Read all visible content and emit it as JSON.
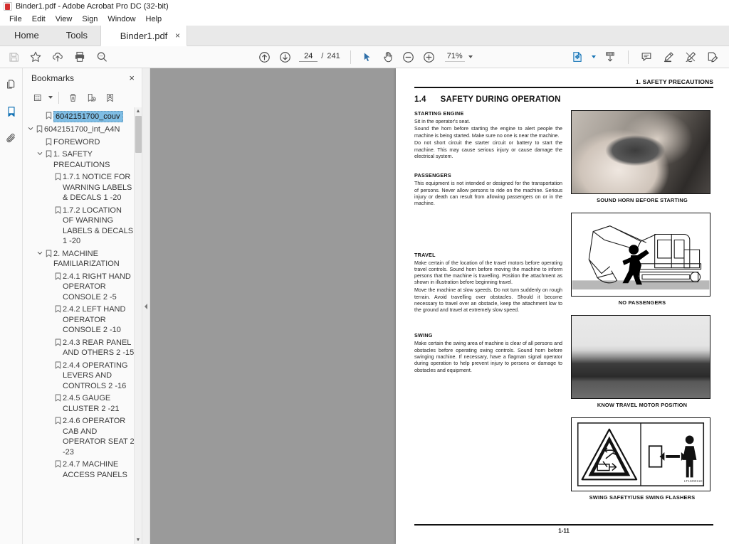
{
  "window": {
    "title": "Binder1.pdf - Adobe Acrobat Pro DC (32-bit)",
    "app_icon": "pdf-file-icon"
  },
  "menubar": {
    "items": [
      {
        "label": "File"
      },
      {
        "label": "Edit"
      },
      {
        "label": "View"
      },
      {
        "label": "Sign"
      },
      {
        "label": "Window"
      },
      {
        "label": "Help"
      }
    ]
  },
  "tabs": {
    "home": "Home",
    "tools": "Tools",
    "document": "Binder1.pdf",
    "close_glyph": "×"
  },
  "toolbar": {
    "left_icons": [
      {
        "name": "save-icon",
        "label": "Save",
        "disabled": true
      },
      {
        "name": "star-icon",
        "label": "Add to favorites",
        "disabled": false
      },
      {
        "name": "cloud-upload-icon",
        "label": "Upload to cloud",
        "disabled": false
      },
      {
        "name": "print-icon",
        "label": "Print file",
        "disabled": false
      },
      {
        "name": "search-icon",
        "label": "Find text",
        "disabled": false
      }
    ],
    "page_prev": "Previous page",
    "page_next": "Next page",
    "page_current": "24",
    "page_separator": "/",
    "page_total": "241",
    "select_tool": "Select tool",
    "hand_tool": "Hand tool",
    "zoom_out": "Zoom out",
    "zoom_in": "Zoom in",
    "zoom_value": "71%",
    "fit_page": "Fit page",
    "scroll_mode": "Page display / scroll mode",
    "comment": "Add comment",
    "highlight": "Highlight text",
    "draw": "Draw free form",
    "sign": "Fill and sign"
  },
  "rail": {
    "items": [
      {
        "name": "page-thumbnails-icon",
        "label": "Page Thumbnails",
        "selected": false
      },
      {
        "name": "bookmarks-icon",
        "label": "Bookmarks",
        "selected": true
      },
      {
        "name": "attachments-icon",
        "label": "Attachments",
        "selected": false
      }
    ]
  },
  "bookmarks_panel": {
    "title": "Bookmarks",
    "close_glyph": "×",
    "tools": [
      {
        "name": "bookmark-options-icon",
        "label": "Options"
      },
      {
        "name": "delete-bookmark-icon",
        "label": "Delete selected bookmarks"
      },
      {
        "name": "new-bookmark-icon",
        "label": "New bookmark"
      },
      {
        "name": "bookmark-properties-icon",
        "label": "Bookmark properties"
      }
    ],
    "scroll_up_glyph": "▲",
    "scroll_down_glyph": "▼",
    "items": [
      {
        "label": "6042151700_couv",
        "indent": 1,
        "twisty": "none",
        "selected": true
      },
      {
        "label": "6042151700_int_A4N",
        "indent": 0,
        "twisty": "open",
        "selected": false
      },
      {
        "label": "FOREWORD",
        "indent": 1,
        "twisty": "none",
        "selected": false
      },
      {
        "label": "1. SAFETY PRECAUTIONS",
        "indent": 1,
        "twisty": "open",
        "selected": false
      },
      {
        "label": "1.7.1 NOTICE FOR WARNING LABELS & DECALS 1 -20",
        "indent": 2,
        "twisty": "none",
        "selected": false
      },
      {
        "label": "1.7.2 LOCATION OF WARNING LABELS & DECALS 1 -20",
        "indent": 2,
        "twisty": "none",
        "selected": false
      },
      {
        "label": "2. MACHINE FAMILIARIZATION",
        "indent": 1,
        "twisty": "open",
        "selected": false
      },
      {
        "label": "2.4.1 RIGHT HAND OPERATOR CONSOLE 2 -5",
        "indent": 2,
        "twisty": "none",
        "selected": false
      },
      {
        "label": "2.4.2 LEFT HAND OPERATOR CONSOLE 2 -10",
        "indent": 2,
        "twisty": "none",
        "selected": false
      },
      {
        "label": "2.4.3 REAR PANEL AND OTHERS 2 -15",
        "indent": 2,
        "twisty": "none",
        "selected": false
      },
      {
        "label": "2.4.4 OPERATING LEVERS AND CONTROLS 2 -16",
        "indent": 2,
        "twisty": "none",
        "selected": false
      },
      {
        "label": "2.4.5 GAUGE CLUSTER 2 -21",
        "indent": 2,
        "twisty": "none",
        "selected": false
      },
      {
        "label": "2.4.6 OPERATOR CAB AND OPERATOR SEAT 2 -23",
        "indent": 2,
        "twisty": "none",
        "selected": false
      },
      {
        "label": "2.4.7 MACHINE ACCESS PANELS",
        "indent": 2,
        "twisty": "none",
        "selected": false
      }
    ]
  },
  "document": {
    "running_header": "1. SAFETY PRECAUTIONS",
    "section_number": "1.4",
    "section_title": "SAFETY DURING OPERATION",
    "page_footer": "1-11",
    "blocks": [
      {
        "heading": "STARTING ENGINE",
        "paragraphs": [
          "Sit in the operator's seat.",
          "Sound the horn before starting the engine to alert people the machine is being started. Make sure no one is near the machine.",
          "Do not short circuit the starter circuit or battery to start the machine. This may cause serious injury or cause damage the electrical system."
        ]
      },
      {
        "heading": "PASSENGERS",
        "paragraphs": [
          "This equipment is not intended or designed for the transportation of persons. Never allow persons to ride on the machine. Serious injury or death can result from allowing passengers on or in the machine."
        ]
      },
      {
        "heading": "TRAVEL",
        "paragraphs": [
          "Make certain of the location of the travel motors before operating travel controls. Sound horn before moving the machine to inform persons that the machine is travelling. Position the attachment as shown in illustration before beginning travel.",
          "Move the machine at slow speeds. Do not turn suddenly on rough terrain. Avoid travelling over obstacles. Should it become necessary to travel over an obstacle, keep the attachment low to the ground and travel at extremely slow speed."
        ]
      },
      {
        "heading": "SWING",
        "paragraphs": [
          "Make certain the swing area of machine is clear of all persons and obstacles before operating swing controls. Sound horn before swinging machine. If necessary, have a flagman signal operator during operation to help prevent injury to persons or damage to obstacles and equipment."
        ]
      }
    ],
    "figures": [
      {
        "name": "figure-sound-horn",
        "kind": "photo-horn",
        "caption": "SOUND HORN BEFORE STARTING"
      },
      {
        "name": "figure-no-passengers",
        "kind": "lineart-excavator",
        "caption": "NO PASSENGERS"
      },
      {
        "name": "figure-travel-motor",
        "kind": "photo-track",
        "caption": "KNOW TRAVEL MOTOR POSITION"
      },
      {
        "name": "figure-swing-safety",
        "kind": "lineart-swing",
        "caption": "SWING SAFETY/USE SWING FLASHERS"
      }
    ]
  },
  "colors": {
    "accent": "#1473b5",
    "selection": "#7fbde4",
    "viewport_bg": "#9a9a9a",
    "toolbar_bg": "#fafafa",
    "tabstrip_bg": "#e9e9e9"
  }
}
